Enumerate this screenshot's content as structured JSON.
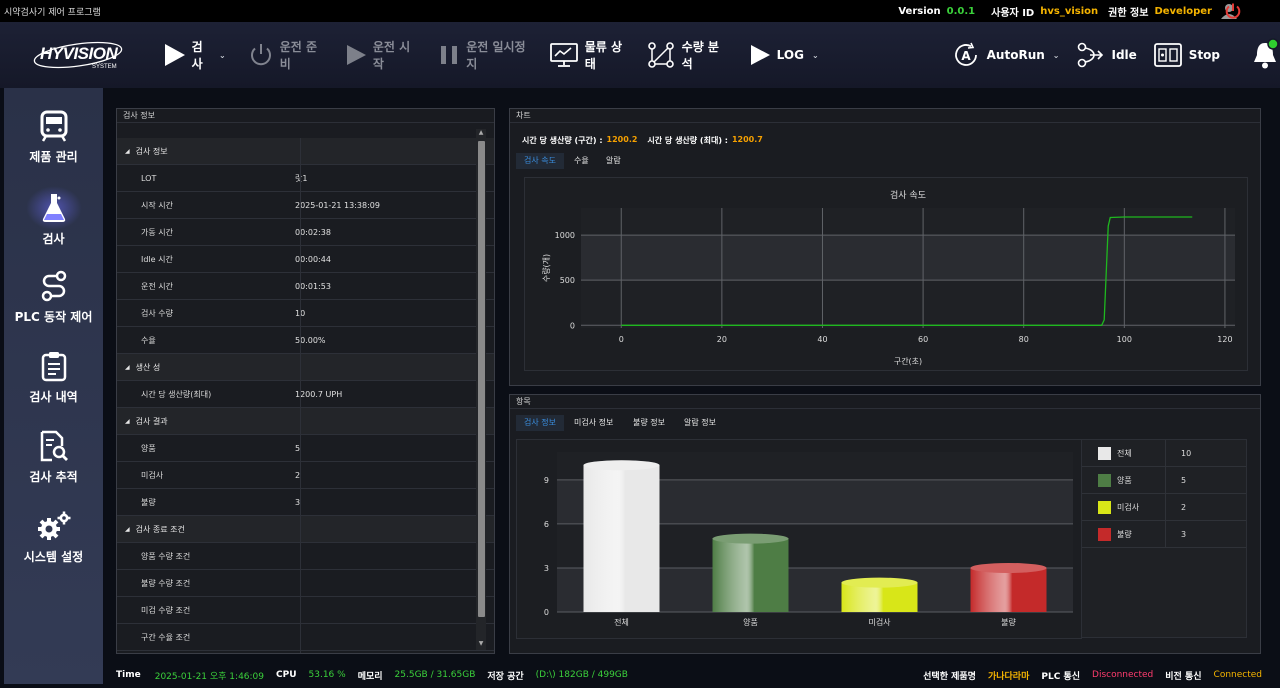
{
  "titlebar": {
    "title": "시약검사기 제어 프로그램",
    "version_label": "Version",
    "version_value": "0.0.1",
    "user_label": "사용자 ID",
    "user_value": "hvs_vision",
    "auth_label": "권한 정보",
    "auth_value": "Developer"
  },
  "header": {
    "logo_text": "HYVISION",
    "logo_sub": "SYSTEM",
    "buttons": {
      "inspect": "검사",
      "ready": "운전 준비",
      "start": "운전 시작",
      "pause": "운전 일시정지",
      "logistics": "물류 상태",
      "analysis": "수량 분석",
      "log": "LOG",
      "autorun": "AutoRun",
      "idle": "Idle",
      "stop": "Stop"
    }
  },
  "sidebar": {
    "items": [
      "제품 관리",
      "검사",
      "PLC 동작 제어",
      "검사 내역",
      "검사 추적",
      "시스템 설정"
    ]
  },
  "info": {
    "panel_title": "검사 정보",
    "sections": [
      "검사 정보",
      "생산 성",
      "검사 결과",
      "검사 종료 조건"
    ],
    "rows": [
      {
        "label": "LOT",
        "value": "랏1"
      },
      {
        "label": "시작 시간",
        "value": "2025-01-21 13:38:09"
      },
      {
        "label": "가동 시간",
        "value": "00:02:38"
      },
      {
        "label": "Idle 시간",
        "value": "00:00:44"
      },
      {
        "label": "운전 시간",
        "value": "00:01:53"
      },
      {
        "label": "검사 수량",
        "value": "10"
      },
      {
        "label": "수율",
        "value": "50.00%"
      },
      {
        "label": "시간 당 생산량(최대)",
        "value": "1200.7 UPH"
      },
      {
        "label": "양품",
        "value": "5"
      },
      {
        "label": "미검사",
        "value": "2"
      },
      {
        "label": "불량",
        "value": "3"
      }
    ],
    "conditions": [
      "양품 수량 조건",
      "불량 수량 조건",
      "미검 수량 조건",
      "구간 수율 조건"
    ]
  },
  "chart_panel": {
    "title": "차트",
    "uph_label_interval": "시간 당 생산량 (구간) :",
    "uph_value_interval": "1200.2",
    "uph_label_max": "시간 당 생산량 (최대) :",
    "uph_value_max": "1200.7",
    "tabs": [
      "검사 속도",
      "수율",
      "알람"
    ]
  },
  "items_panel": {
    "title": "항목",
    "tabs": [
      "검사 정보",
      "미검사 정보",
      "불량 정보",
      "알람 정보"
    ],
    "legend": [
      {
        "name": "전체",
        "value": "10"
      },
      {
        "name": "양품",
        "value": "5"
      },
      {
        "name": "미검사",
        "value": "2"
      },
      {
        "name": "불량",
        "value": "3"
      }
    ]
  },
  "chart_data": [
    {
      "type": "line",
      "title": "검사 속도",
      "xlabel": "구간(초)",
      "ylabel": "수량(개)",
      "xlim": [
        -8,
        122
      ],
      "ylim": [
        -30,
        1300
      ],
      "xticks": [
        0,
        20,
        40,
        60,
        80,
        100,
        120
      ],
      "yticks": [
        0,
        500,
        1000
      ],
      "grid": true,
      "color": "#1fb81f",
      "x": [
        0,
        20,
        40,
        60,
        80,
        95.5,
        96,
        96.8,
        97.2,
        100,
        105,
        110,
        113.5
      ],
      "y": [
        0,
        0,
        0,
        0,
        0,
        0,
        60,
        1100,
        1195,
        1200,
        1200,
        1200,
        1200
      ]
    },
    {
      "type": "bar",
      "categories": [
        "전체",
        "양품",
        "미검사",
        "불량"
      ],
      "values": [
        10,
        5,
        2,
        3
      ],
      "colors": [
        "#e8e8e8",
        "#4e7d45",
        "#d8e618",
        "#c42a2a"
      ],
      "ylim": [
        0,
        10.9
      ],
      "yticks": [
        0,
        3,
        6,
        9
      ],
      "grid": true
    }
  ],
  "footer": {
    "time_label": "Time",
    "time_value": "2025-01-21 오후 1:46:09",
    "cpu_label": "CPU",
    "cpu_value": "53.16 %",
    "mem_label": "메모리",
    "mem_value": "25.5GB / 31.65GB",
    "disk_label": "저장 공간",
    "disk_value": "(D:\\) 182GB / 499GB",
    "product_label": "선택한 제품명",
    "product_value": "가나다라마",
    "plc_label": "PLC 통신",
    "plc_value": "Disconnected",
    "vision_label": "비전 통신",
    "vision_value": "Connected"
  }
}
